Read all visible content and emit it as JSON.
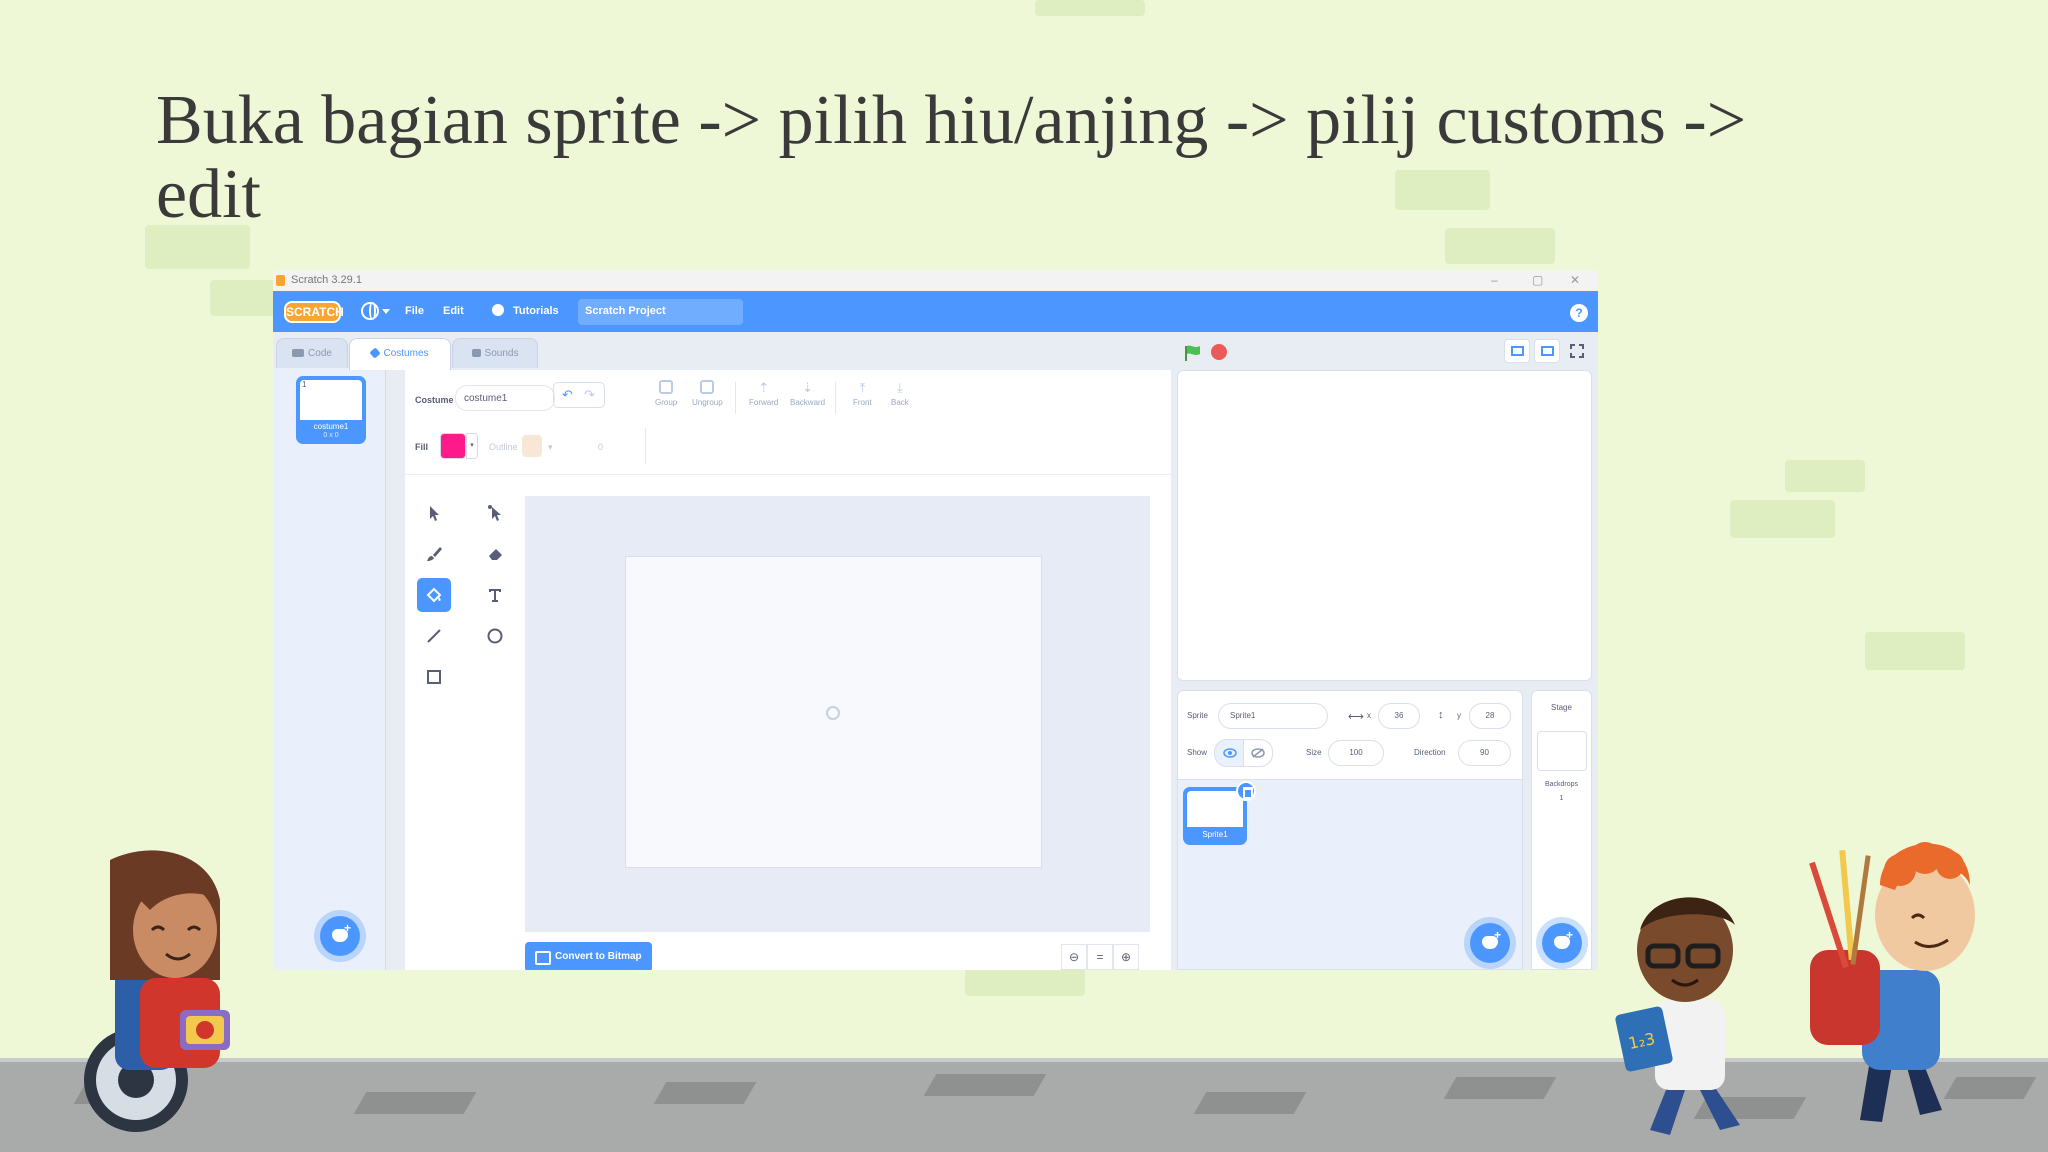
{
  "slide": {
    "title": "Buka bagian sprite -> pilih hiu/anjing -> pilij customs -> edit"
  },
  "window": {
    "title": "Scratch 3.29.1"
  },
  "menubar": {
    "logo": "SCRATCH",
    "file": "File",
    "edit": "Edit",
    "tutorials": "Tutorials",
    "project_title": "Scratch Project",
    "help": "?"
  },
  "tabs": [
    {
      "label": "Code",
      "icon": "code-blocks-icon"
    },
    {
      "label": "Costumes",
      "icon": "paintbrush-icon",
      "active": true
    },
    {
      "label": "Sounds",
      "icon": "speaker-icon"
    }
  ],
  "costume_list": [
    {
      "number": "1",
      "name": "costume1",
      "size": "0 x 0"
    }
  ],
  "paint_editor": {
    "costume_label": "Costume",
    "costume_name": "costume1",
    "group": "Group",
    "ungroup": "Ungroup",
    "forward": "Forward",
    "backward": "Backward",
    "front": "Front",
    "back": "Back",
    "fill_label": "Fill",
    "fill_color": "#ff1a8c",
    "outline_label": "Outline",
    "outline_width": "0",
    "convert_button": "Convert to Bitmap",
    "zoom_reset": "="
  },
  "tools": [
    {
      "name": "select",
      "active": false
    },
    {
      "name": "reshape",
      "active": false
    },
    {
      "name": "brush",
      "active": false
    },
    {
      "name": "eraser",
      "active": false
    },
    {
      "name": "fill",
      "active": true
    },
    {
      "name": "text",
      "active": false
    },
    {
      "name": "line",
      "active": false
    },
    {
      "name": "circle",
      "active": false
    },
    {
      "name": "rectangle",
      "active": false
    }
  ],
  "sprite_info": {
    "sprite_label": "Sprite",
    "sprite_name": "Sprite1",
    "x_label": "x",
    "x_value": "36",
    "y_label": "y",
    "y_value": "28",
    "show_label": "Show",
    "size_label": "Size",
    "size_value": "100",
    "direction_label": "Direction",
    "direction_value": "90"
  },
  "sprites": [
    {
      "name": "Sprite1"
    }
  ],
  "stage_pane": {
    "label": "Stage",
    "backdrops_label": "Backdrops",
    "backdrops_count": "1"
  },
  "colors": {
    "scratch_blue": "#4c97ff",
    "slide_background": "#eef7d6",
    "stop_red": "#ec5959",
    "flag_green": "#4cbf56"
  }
}
